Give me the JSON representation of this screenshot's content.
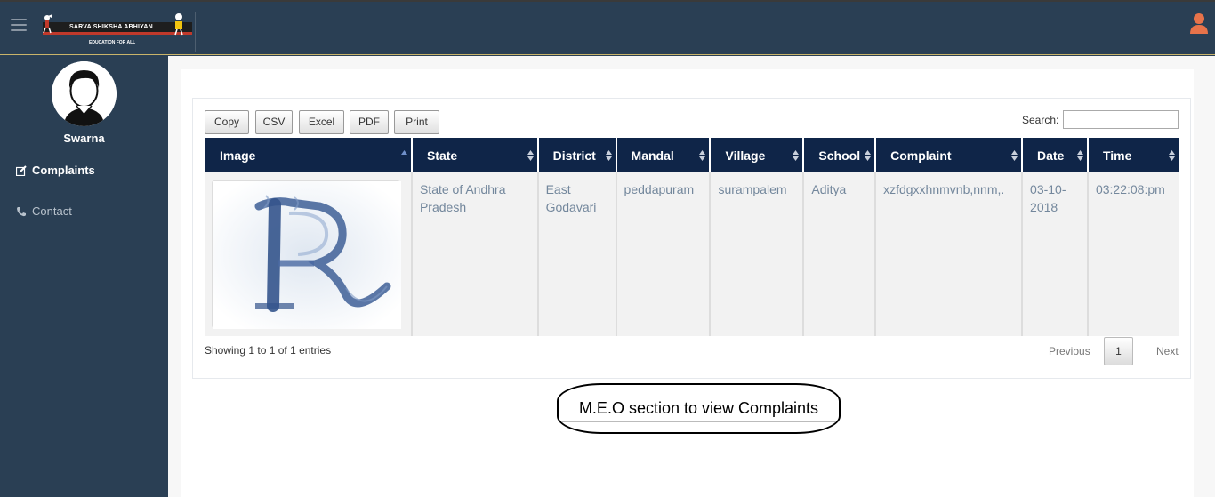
{
  "header": {
    "logo_text": "SARVA SHIKSHA ABHIYAN",
    "logo_subtext": "EDUCATION FOR ALL",
    "menu_icon": "hamburger-icon",
    "user_icon": "user-icon"
  },
  "sidebar": {
    "profile_name": "Swarna",
    "items": [
      {
        "label": "Complaints",
        "icon": "edit-icon",
        "active": true
      },
      {
        "label": "Contact",
        "icon": "phone-icon",
        "active": false
      }
    ]
  },
  "toolbar": {
    "buttons": [
      "Copy",
      "CSV",
      "Excel",
      "PDF",
      "Print"
    ],
    "search_label": "Search:",
    "search_value": ""
  },
  "table": {
    "columns": [
      "Image",
      "State",
      "District",
      "Mandal",
      "Village",
      "School",
      "Complaint",
      "Date",
      "Time"
    ],
    "rows": [
      {
        "image": "letter-r-image",
        "state": "State of Andhra Pradesh",
        "district": "East Godavari",
        "mandal": "peddapuram",
        "village": "surampalem",
        "school": "Aditya",
        "complaint": "xzfdgxxhnmvnb,nnm,.",
        "date": "03-10-2018",
        "time": "03:22:08:pm"
      }
    ]
  },
  "footer": {
    "info": "Showing 1 to 1 of 1 entries",
    "previous": "Previous",
    "page": "1",
    "next": "Next"
  },
  "caption": "M.E.O section to view Complaints",
  "colors": {
    "sidebar_bg": "#2a3f54",
    "table_header_bg": "#0f2548",
    "user_icon": "#e8734a"
  }
}
